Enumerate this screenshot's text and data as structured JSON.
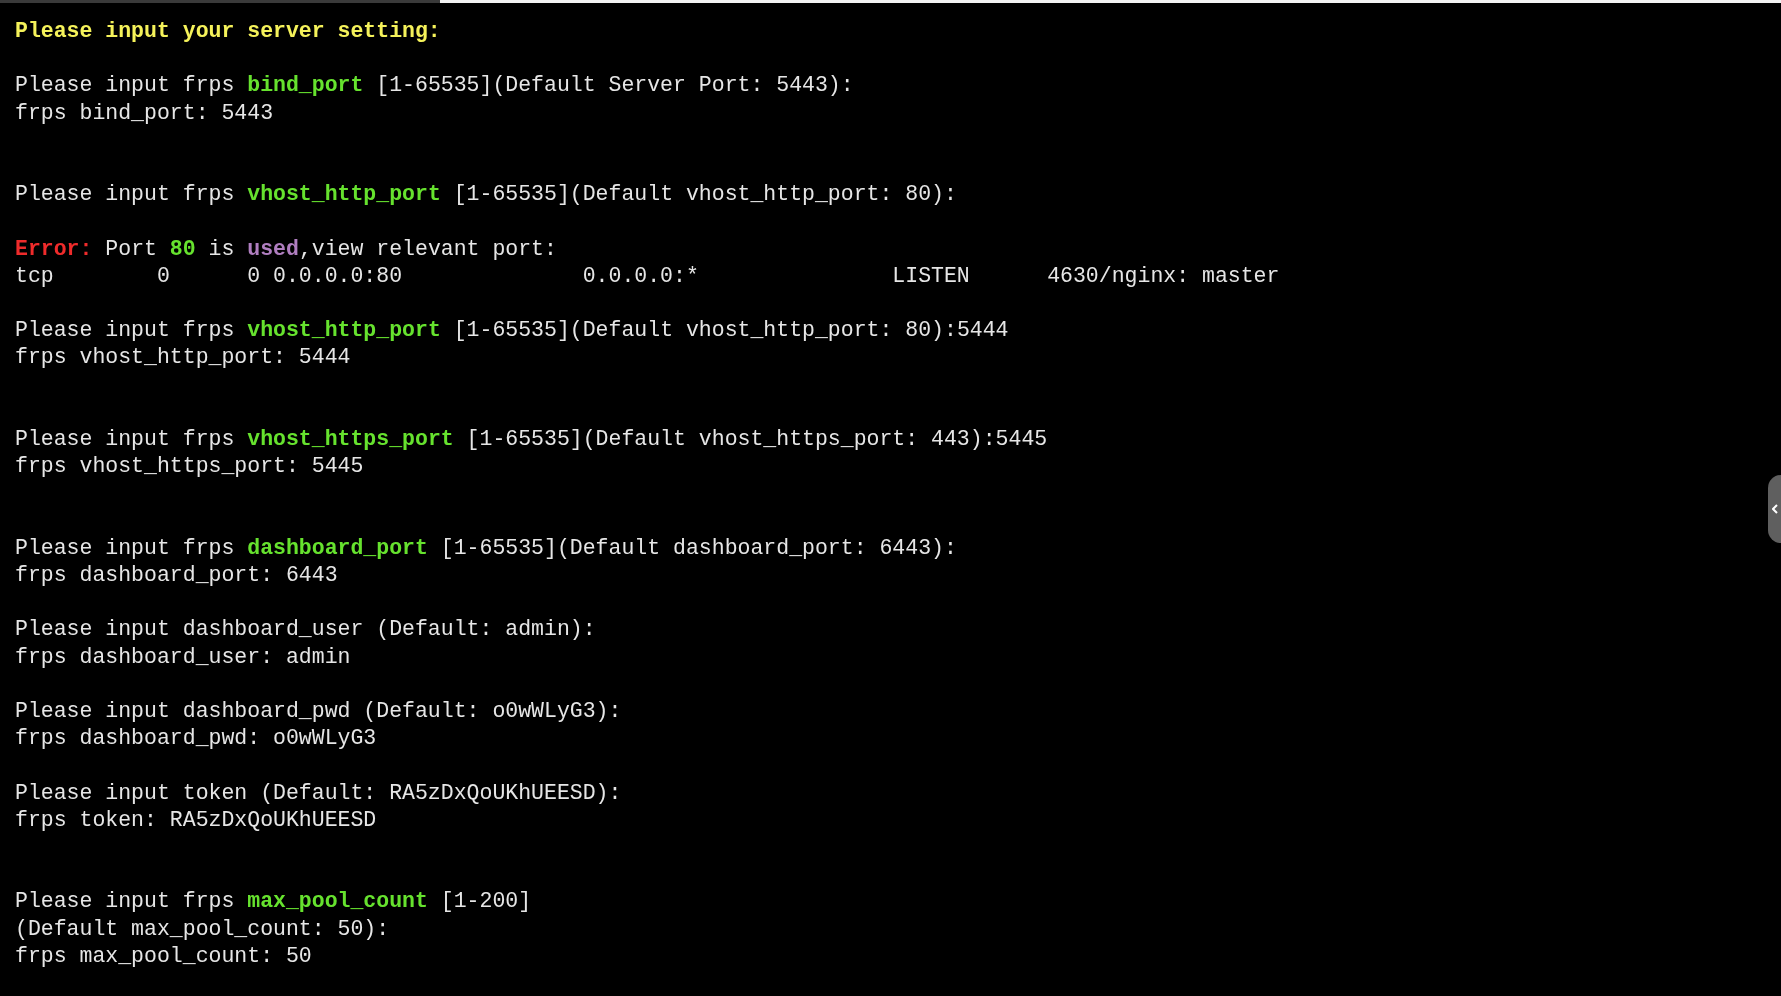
{
  "terminal": {
    "blocks": [
      {
        "extra_blank_line": false,
        "lines": [
          [
            {
              "text": "Please input your server setting:",
              "kind": "title"
            }
          ]
        ]
      },
      {
        "extra_blank_line": false,
        "lines": [
          [
            {
              "text": "Please input frps ",
              "kind": "plain"
            },
            {
              "text": "bind_port",
              "kind": "key"
            },
            {
              "text": " [1-65535](Default Server Port: 5443):",
              "kind": "plain"
            }
          ],
          [
            {
              "text": "frps bind_port: 5443",
              "kind": "plain"
            }
          ]
        ]
      },
      {
        "extra_blank_line": true,
        "lines": [
          [
            {
              "text": "Please input frps ",
              "kind": "plain"
            },
            {
              "text": "vhost_http_port",
              "kind": "key"
            },
            {
              "text": " [1-65535](Default vhost_http_port: 80):",
              "kind": "plain"
            }
          ]
        ]
      },
      {
        "extra_blank_line": false,
        "lines": [
          [
            {
              "text": "Error:",
              "kind": "error"
            },
            {
              "text": " Port ",
              "kind": "plain"
            },
            {
              "text": "80",
              "kind": "key"
            },
            {
              "text": " is ",
              "kind": "plain"
            },
            {
              "text": "used",
              "kind": "used"
            },
            {
              "text": ",view relevant port:",
              "kind": "plain"
            }
          ],
          [
            {
              "text": "tcp        0      0 0.0.0.0:80              0.0.0.0:*               LISTEN      4630/nginx: master",
              "kind": "plain"
            }
          ]
        ]
      },
      {
        "extra_blank_line": false,
        "lines": [
          [
            {
              "text": "Please input frps ",
              "kind": "plain"
            },
            {
              "text": "vhost_http_port",
              "kind": "key"
            },
            {
              "text": " [1-65535](Default vhost_http_port: 80):5444",
              "kind": "plain"
            }
          ],
          [
            {
              "text": "frps vhost_http_port: 5444",
              "kind": "plain"
            }
          ]
        ]
      },
      {
        "extra_blank_line": true,
        "lines": [
          [
            {
              "text": "Please input frps ",
              "kind": "plain"
            },
            {
              "text": "vhost_https_port",
              "kind": "key"
            },
            {
              "text": " [1-65535](Default vhost_https_port: 443):5445",
              "kind": "plain"
            }
          ],
          [
            {
              "text": "frps vhost_https_port: 5445",
              "kind": "plain"
            }
          ]
        ]
      },
      {
        "extra_blank_line": true,
        "lines": [
          [
            {
              "text": "Please input frps ",
              "kind": "plain"
            },
            {
              "text": "dashboard_port",
              "kind": "key"
            },
            {
              "text": " [1-65535](Default dashboard_port: 6443):",
              "kind": "plain"
            }
          ],
          [
            {
              "text": "frps dashboard_port: 6443",
              "kind": "plain"
            }
          ]
        ]
      },
      {
        "extra_blank_line": false,
        "lines": [
          [
            {
              "text": "Please input dashboard_user (Default: admin):",
              "kind": "plain"
            }
          ],
          [
            {
              "text": "frps dashboard_user: admin",
              "kind": "plain"
            }
          ]
        ]
      },
      {
        "extra_blank_line": false,
        "lines": [
          [
            {
              "text": "Please input dashboard_pwd (Default: o0wWLyG3):",
              "kind": "plain"
            }
          ],
          [
            {
              "text": "frps dashboard_pwd: o0wWLyG3",
              "kind": "plain"
            }
          ]
        ]
      },
      {
        "extra_blank_line": false,
        "lines": [
          [
            {
              "text": "Please input token (Default: RA5zDxQoUKhUEESD):",
              "kind": "plain"
            }
          ],
          [
            {
              "text": "frps token: RA5zDxQoUKhUEESD",
              "kind": "plain"
            }
          ]
        ]
      },
      {
        "extra_blank_line": true,
        "lines": [
          [
            {
              "text": "Please input frps ",
              "kind": "plain"
            },
            {
              "text": "max_pool_count",
              "kind": "key"
            },
            {
              "text": " [1-200]",
              "kind": "plain"
            }
          ],
          [
            {
              "text": "(Default max_pool_count: 50):",
              "kind": "plain"
            }
          ],
          [
            {
              "text": "frps max_pool_count: 50",
              "kind": "plain"
            }
          ]
        ]
      }
    ]
  }
}
